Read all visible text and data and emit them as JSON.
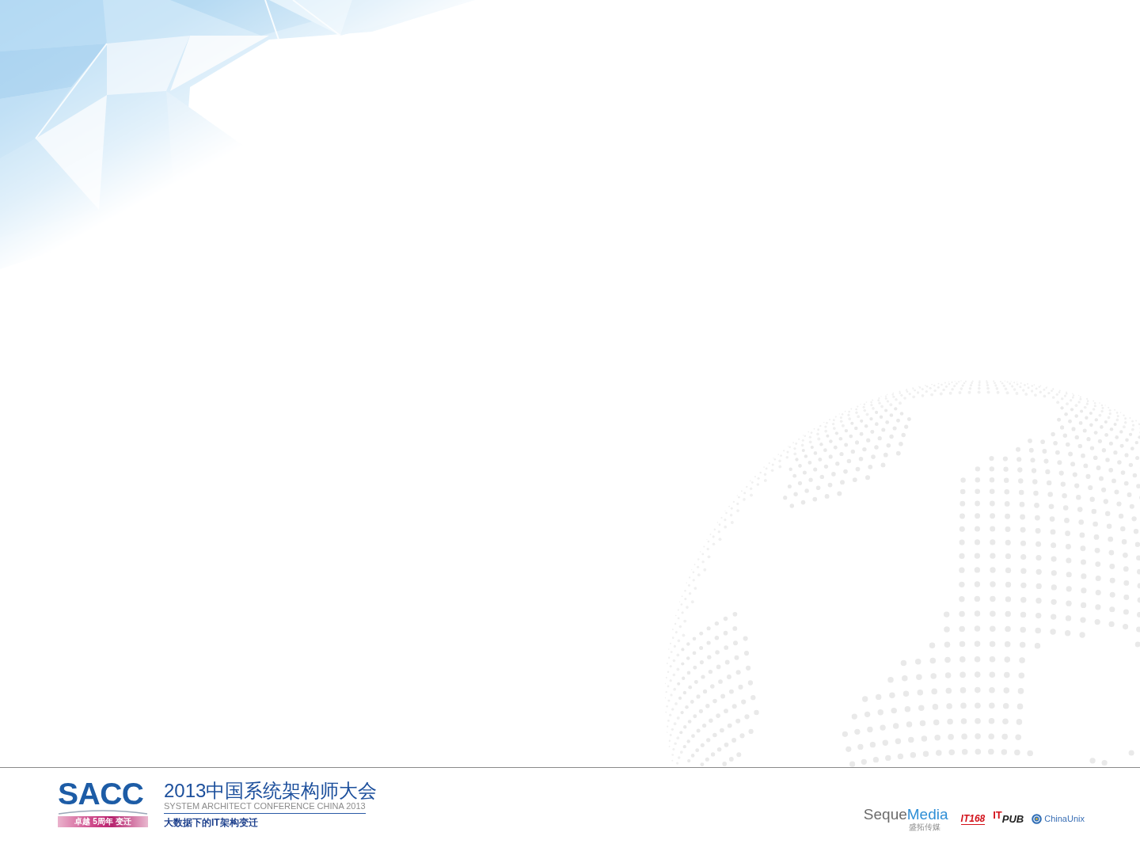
{
  "footer": {
    "event_logo": {
      "wordmark": "SACC",
      "tagline": "卓越 5周年 变迁"
    },
    "event_title": "2013中国系统架构师大会",
    "event_subtitle": "SYSTEM ARCHITECT CONFERENCE CHINA 2013",
    "theme": "大数据下的IT架构变迁",
    "partners": [
      {
        "kind": "two-tone",
        "name": "Seque",
        "name_accent": "Media",
        "subtitle": "盛拓传媒"
      },
      {
        "kind": "italic",
        "name": "IT168"
      },
      {
        "kind": "raised-prefix",
        "prefix": "IT",
        "name": "PUB"
      },
      {
        "kind": "with-icon",
        "name": "ChinaUnix"
      }
    ]
  }
}
